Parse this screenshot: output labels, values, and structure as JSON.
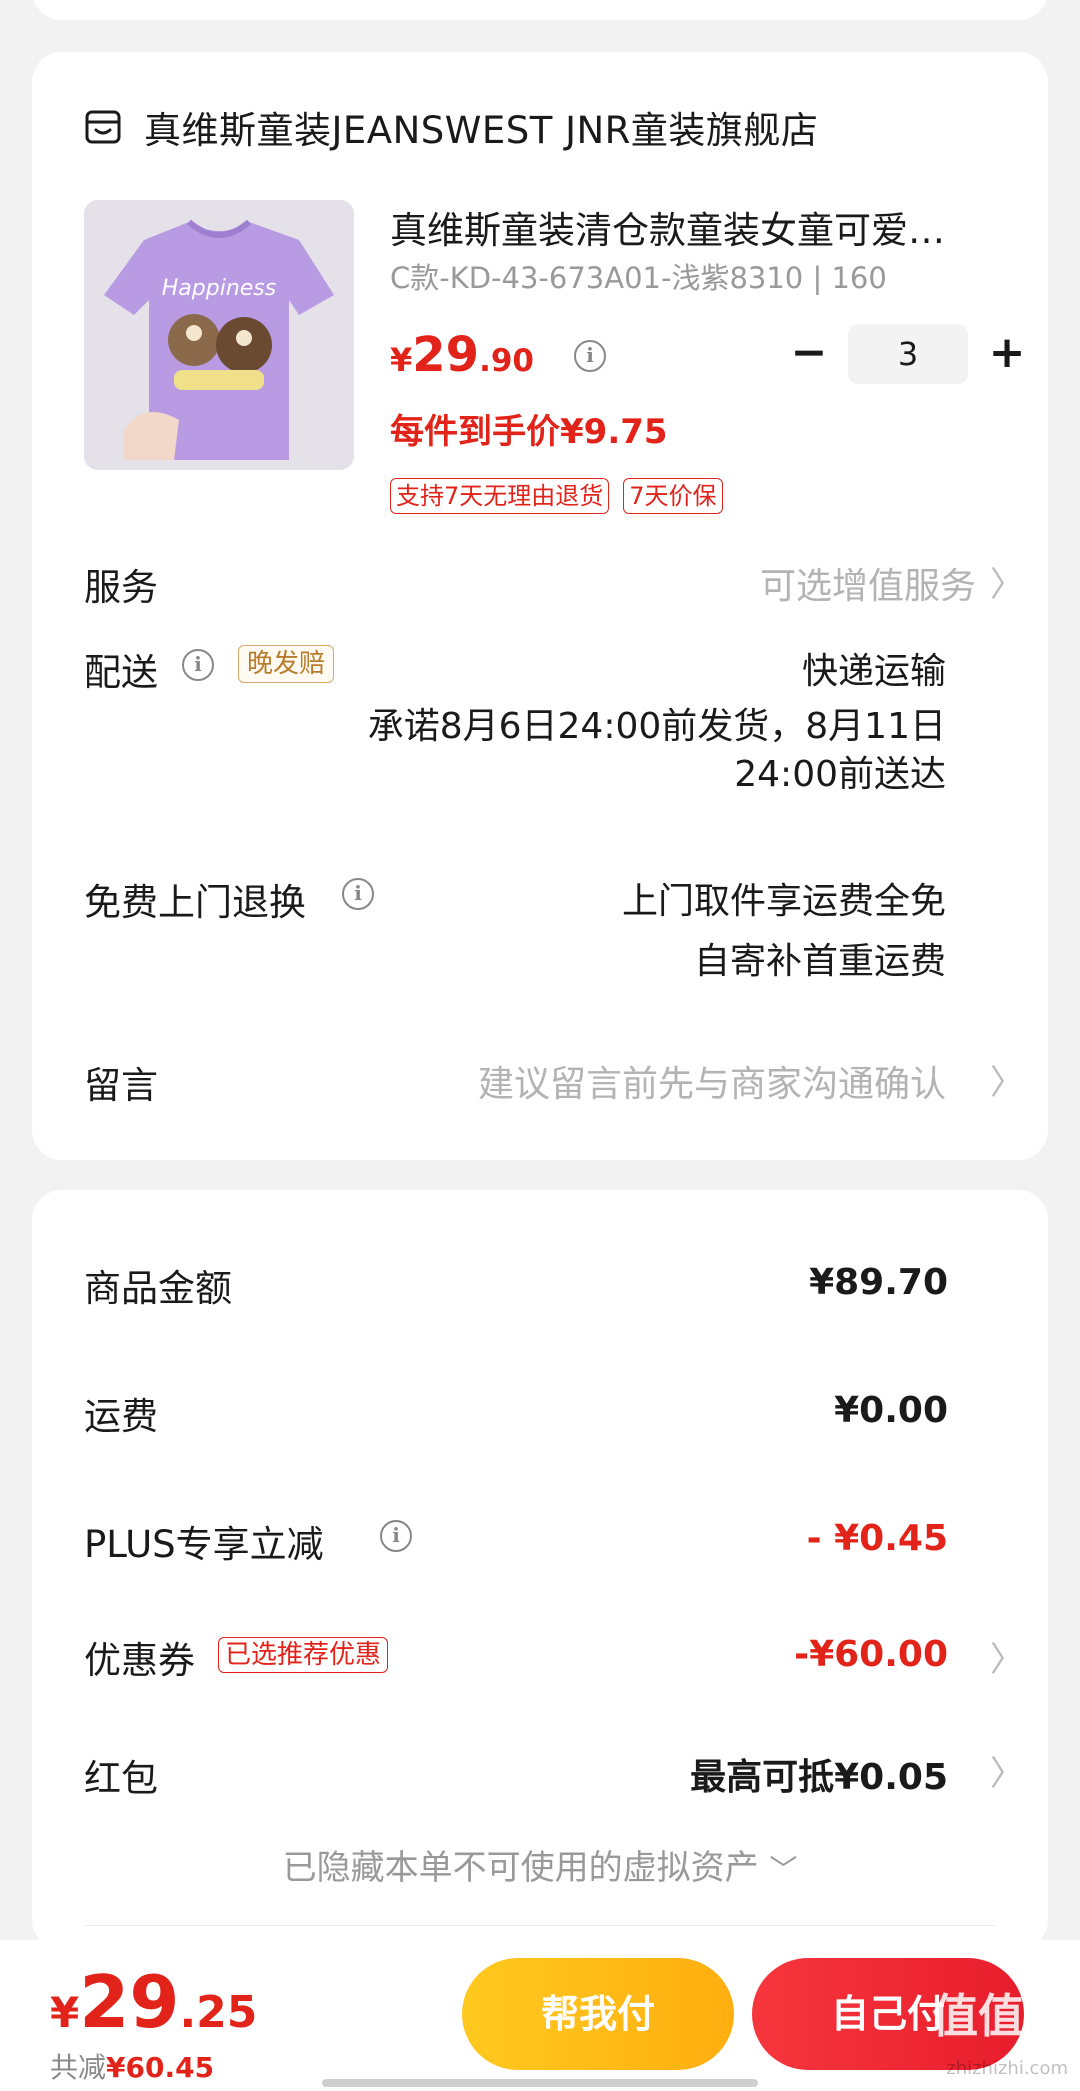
{
  "store": {
    "name": "真维斯童装JEANSWEST JNR童装旗舰店"
  },
  "product": {
    "title": "真维斯童装清仓款童装女童可爱…",
    "spec": "C款-KD-43-673A01-浅紫8310 | 160",
    "price_symbol": "¥",
    "price_int": "29",
    "price_dec": ".90",
    "quantity": "3",
    "unit_price": "每件到手价¥9.75",
    "tags": [
      "支持7天无理由退货",
      "7天价保"
    ],
    "image_text": "Happiness"
  },
  "services": {
    "service_label": "服务",
    "service_value": "可选增值服务",
    "delivery_label": "配送",
    "late_tag": "晚发赔",
    "delivery_method": "快递运输",
    "delivery_promise_line1": "承诺8月6日24:00前发货，8月11日",
    "delivery_promise_line2": "24:00前送达",
    "return_label": "免费上门退换",
    "return_line1": "上门取件享运费全免",
    "return_line2": "自寄补首重运费",
    "message_label": "留言",
    "message_placeholder": "建议留言前先与商家沟通确认"
  },
  "pricing": {
    "goods_label": "商品金额",
    "goods_value": "¥89.70",
    "shipping_label": "运费",
    "shipping_value": "¥0.00",
    "plus_label": "PLUS专享立减",
    "plus_value": "- ¥0.45",
    "coupon_label": "优惠券",
    "coupon_tag": "已选推荐优惠",
    "coupon_value": "-¥60.00",
    "redpack_label": "红包",
    "redpack_value": "最高可抵¥0.05",
    "hidden_assets": "已隐藏本单不可使用的虚拟资产"
  },
  "footer": {
    "total_symbol": "¥",
    "total_int": "29",
    "total_dec": ".25",
    "saved_label": "共减",
    "saved_value": "¥60.45",
    "help_pay_label": "帮我付",
    "self_pay_label": "自己付",
    "watermark": "值值值",
    "watermark_sub": "zhizhizhi.com"
  },
  "colors": {
    "accent_red": "#e2231a",
    "help_yellow": "#ffb814",
    "tag_gold": "#b97c2a"
  }
}
